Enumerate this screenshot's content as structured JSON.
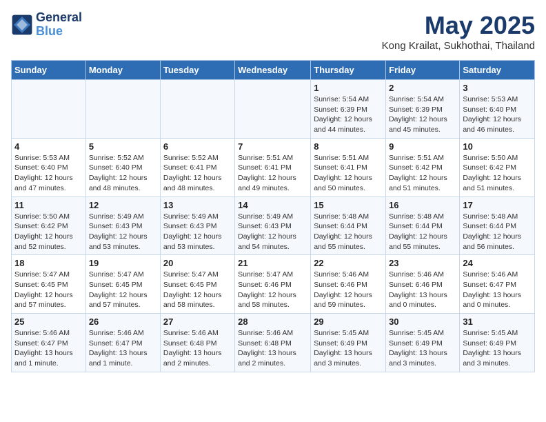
{
  "header": {
    "logo_line1": "General",
    "logo_line2": "Blue",
    "title": "May 2025",
    "subtitle": "Kong Krailat, Sukhothai, Thailand"
  },
  "weekdays": [
    "Sunday",
    "Monday",
    "Tuesday",
    "Wednesday",
    "Thursday",
    "Friday",
    "Saturday"
  ],
  "weeks": [
    [
      {
        "day": "",
        "info": ""
      },
      {
        "day": "",
        "info": ""
      },
      {
        "day": "",
        "info": ""
      },
      {
        "day": "",
        "info": ""
      },
      {
        "day": "1",
        "info": "Sunrise: 5:54 AM\nSunset: 6:39 PM\nDaylight: 12 hours\nand 44 minutes."
      },
      {
        "day": "2",
        "info": "Sunrise: 5:54 AM\nSunset: 6:39 PM\nDaylight: 12 hours\nand 45 minutes."
      },
      {
        "day": "3",
        "info": "Sunrise: 5:53 AM\nSunset: 6:40 PM\nDaylight: 12 hours\nand 46 minutes."
      }
    ],
    [
      {
        "day": "4",
        "info": "Sunrise: 5:53 AM\nSunset: 6:40 PM\nDaylight: 12 hours\nand 47 minutes."
      },
      {
        "day": "5",
        "info": "Sunrise: 5:52 AM\nSunset: 6:40 PM\nDaylight: 12 hours\nand 48 minutes."
      },
      {
        "day": "6",
        "info": "Sunrise: 5:52 AM\nSunset: 6:41 PM\nDaylight: 12 hours\nand 48 minutes."
      },
      {
        "day": "7",
        "info": "Sunrise: 5:51 AM\nSunset: 6:41 PM\nDaylight: 12 hours\nand 49 minutes."
      },
      {
        "day": "8",
        "info": "Sunrise: 5:51 AM\nSunset: 6:41 PM\nDaylight: 12 hours\nand 50 minutes."
      },
      {
        "day": "9",
        "info": "Sunrise: 5:51 AM\nSunset: 6:42 PM\nDaylight: 12 hours\nand 51 minutes."
      },
      {
        "day": "10",
        "info": "Sunrise: 5:50 AM\nSunset: 6:42 PM\nDaylight: 12 hours\nand 51 minutes."
      }
    ],
    [
      {
        "day": "11",
        "info": "Sunrise: 5:50 AM\nSunset: 6:42 PM\nDaylight: 12 hours\nand 52 minutes."
      },
      {
        "day": "12",
        "info": "Sunrise: 5:49 AM\nSunset: 6:43 PM\nDaylight: 12 hours\nand 53 minutes."
      },
      {
        "day": "13",
        "info": "Sunrise: 5:49 AM\nSunset: 6:43 PM\nDaylight: 12 hours\nand 53 minutes."
      },
      {
        "day": "14",
        "info": "Sunrise: 5:49 AM\nSunset: 6:43 PM\nDaylight: 12 hours\nand 54 minutes."
      },
      {
        "day": "15",
        "info": "Sunrise: 5:48 AM\nSunset: 6:44 PM\nDaylight: 12 hours\nand 55 minutes."
      },
      {
        "day": "16",
        "info": "Sunrise: 5:48 AM\nSunset: 6:44 PM\nDaylight: 12 hours\nand 55 minutes."
      },
      {
        "day": "17",
        "info": "Sunrise: 5:48 AM\nSunset: 6:44 PM\nDaylight: 12 hours\nand 56 minutes."
      }
    ],
    [
      {
        "day": "18",
        "info": "Sunrise: 5:47 AM\nSunset: 6:45 PM\nDaylight: 12 hours\nand 57 minutes."
      },
      {
        "day": "19",
        "info": "Sunrise: 5:47 AM\nSunset: 6:45 PM\nDaylight: 12 hours\nand 57 minutes."
      },
      {
        "day": "20",
        "info": "Sunrise: 5:47 AM\nSunset: 6:45 PM\nDaylight: 12 hours\nand 58 minutes."
      },
      {
        "day": "21",
        "info": "Sunrise: 5:47 AM\nSunset: 6:46 PM\nDaylight: 12 hours\nand 58 minutes."
      },
      {
        "day": "22",
        "info": "Sunrise: 5:46 AM\nSunset: 6:46 PM\nDaylight: 12 hours\nand 59 minutes."
      },
      {
        "day": "23",
        "info": "Sunrise: 5:46 AM\nSunset: 6:46 PM\nDaylight: 13 hours\nand 0 minutes."
      },
      {
        "day": "24",
        "info": "Sunrise: 5:46 AM\nSunset: 6:47 PM\nDaylight: 13 hours\nand 0 minutes."
      }
    ],
    [
      {
        "day": "25",
        "info": "Sunrise: 5:46 AM\nSunset: 6:47 PM\nDaylight: 13 hours\nand 1 minute."
      },
      {
        "day": "26",
        "info": "Sunrise: 5:46 AM\nSunset: 6:47 PM\nDaylight: 13 hours\nand 1 minute."
      },
      {
        "day": "27",
        "info": "Sunrise: 5:46 AM\nSunset: 6:48 PM\nDaylight: 13 hours\nand 2 minutes."
      },
      {
        "day": "28",
        "info": "Sunrise: 5:46 AM\nSunset: 6:48 PM\nDaylight: 13 hours\nand 2 minutes."
      },
      {
        "day": "29",
        "info": "Sunrise: 5:45 AM\nSunset: 6:49 PM\nDaylight: 13 hours\nand 3 minutes."
      },
      {
        "day": "30",
        "info": "Sunrise: 5:45 AM\nSunset: 6:49 PM\nDaylight: 13 hours\nand 3 minutes."
      },
      {
        "day": "31",
        "info": "Sunrise: 5:45 AM\nSunset: 6:49 PM\nDaylight: 13 hours\nand 3 minutes."
      }
    ]
  ]
}
